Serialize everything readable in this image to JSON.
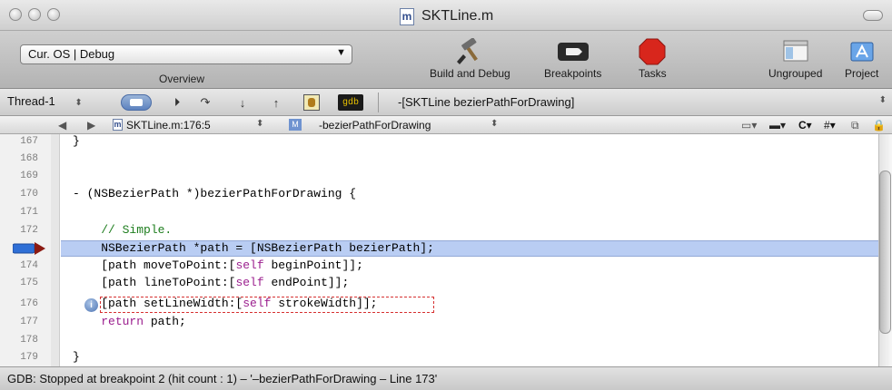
{
  "window": {
    "title": "SKTLine.m",
    "file_icon_letter": "m"
  },
  "toolbar": {
    "overview_value": "Cur. OS | Debug",
    "overview_label": "Overview",
    "build_debug_label": "Build and Debug",
    "breakpoints_label": "Breakpoints",
    "tasks_label": "Tasks",
    "ungrouped_label": "Ungrouped",
    "project_label": "Project"
  },
  "debugger": {
    "thread": "Thread-1",
    "gdb_label": "gdb",
    "stack_frame": "-[SKTLine bezierPathForDrawing]"
  },
  "navbar": {
    "file_location": "SKTLine.m:176:5",
    "method_badge": "M",
    "method": "-bezierPathForDrawing",
    "c_menu": "C",
    "hash_menu": "#"
  },
  "editor": {
    "line_numbers": [
      "167",
      "168",
      "169",
      "170",
      "171",
      "172",
      "",
      "174",
      "175",
      "176",
      "177",
      "178",
      "179"
    ],
    "lines": [
      {
        "text": "}"
      },
      {
        "text": ""
      },
      {
        "text": ""
      },
      {
        "text": "- (NSBezierPath *)bezierPathForDrawing {"
      },
      {
        "text": ""
      },
      {
        "text": "    // Simple."
      },
      {
        "text": "    NSBezierPath *path = [NSBezierPath bezierPath];"
      },
      {
        "text": "    [path moveToPoint:[self beginPoint]];"
      },
      {
        "text": "    [path lineToPoint:[self endPoint]];"
      },
      {
        "text": "    [path setLineWidth:[self strokeWidth]];"
      },
      {
        "text": "    return path;"
      },
      {
        "text": ""
      },
      {
        "text": "}"
      }
    ],
    "current_line_marker": "173",
    "colors": {
      "highlight": "#b9cdf3",
      "keyword": "#9b1f8e",
      "comment": "#1d7d1d",
      "breakpoint_arrow": "#2f6fd6"
    }
  },
  "status": {
    "text": "GDB: Stopped at breakpoint 2 (hit count : 1) – '–bezierPathForDrawing – Line 173'"
  }
}
